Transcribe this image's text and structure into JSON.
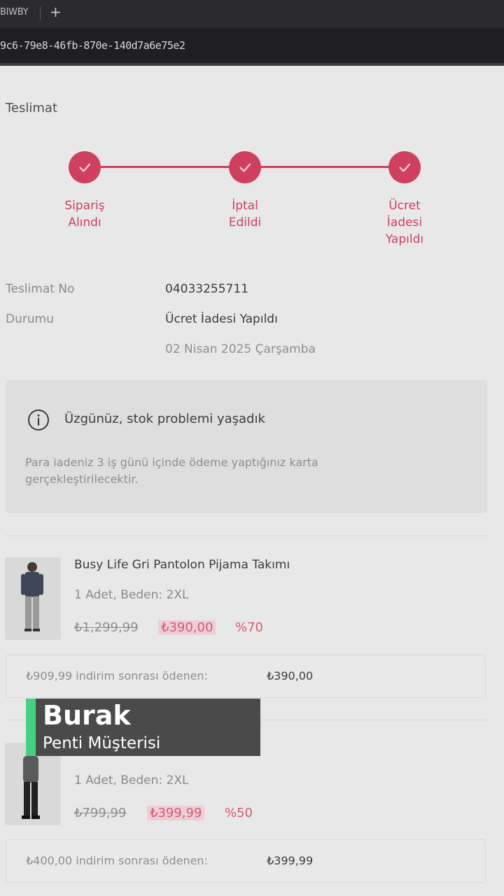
{
  "browser": {
    "tab_title": "BIWBY",
    "new_tab": "+",
    "url": "9c6-79e8-46fb-870e-140d7a6e75e2"
  },
  "delivery": {
    "section_title": "Teslimat",
    "steps": [
      {
        "label": "Sipariş\nAlındı"
      },
      {
        "label": "İptal\nEdildi"
      },
      {
        "label": "Ücret\nİadesi\nYapıldı"
      }
    ],
    "delivery_no_label": "Teslimat No",
    "delivery_no_value": "04033255711",
    "status_label": "Durumu",
    "status_value": "Ücret İadesi Yapıldı",
    "status_date": "02 Nisan 2025 Çarşamba"
  },
  "notice": {
    "title": "Üzgünüz, stok problemi yaşadık",
    "text": "Para iadeniz 3 iş günü içinde ödeme yaptığınız karta gerçekleştirilecektir."
  },
  "products": [
    {
      "name": "Busy Life Gri Pantolon Pijama Takımı",
      "meta": "1 Adet, Beden: 2XL",
      "price_old": "₺1,299,99",
      "price_new": "₺390,00",
      "discount": "%70",
      "summary_label": "₺909,99 indirim sonrası ödenen:",
      "summary_value": "₺390,00"
    },
    {
      "name": "",
      "meta": "1 Adet, Beden: 2XL",
      "price_old": "₺799,99",
      "price_new": "₺399,99",
      "discount": "%50",
      "summary_label": "₺400,00 indirim sonrası ödenen:",
      "summary_value": "₺399,99"
    }
  ],
  "overlay": {
    "name": "Burak",
    "role": "Penti Müşterisi"
  },
  "colors": {
    "accent": "#cf3f5e",
    "overlay_accent": "#45d27e"
  }
}
